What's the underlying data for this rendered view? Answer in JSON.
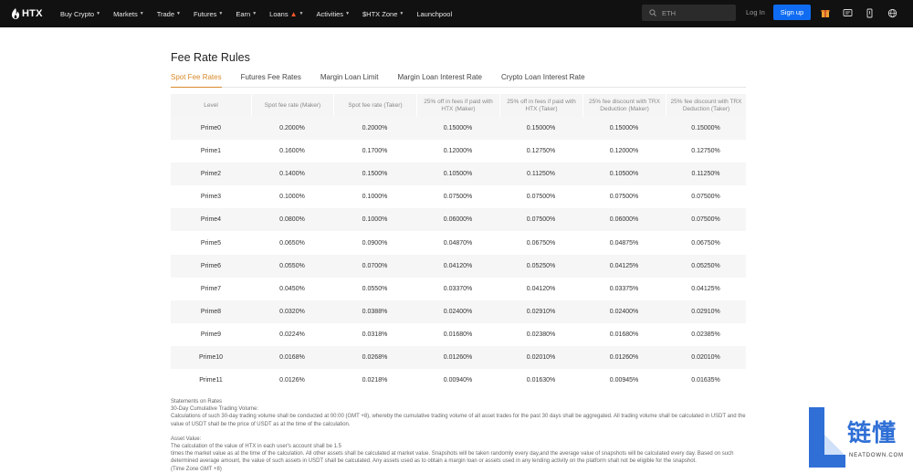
{
  "brand": {
    "logo_text": "HTX"
  },
  "nav": [
    {
      "label": "Buy Crypto",
      "caret": true
    },
    {
      "label": "Markets",
      "caret": true
    },
    {
      "label": "Trade",
      "caret": true
    },
    {
      "label": "Futures",
      "caret": true
    },
    {
      "label": "Earn",
      "caret": true
    },
    {
      "label": "Loans",
      "caret": true,
      "fire": true
    },
    {
      "label": "Activities",
      "caret": true
    },
    {
      "label": "$HTX Zone",
      "caret": true
    },
    {
      "label": "Launchpool",
      "caret": false
    }
  ],
  "search": {
    "placeholder": "ETH"
  },
  "auth": {
    "login": "Log In",
    "signup": "Sign up"
  },
  "page_title": "Fee Rate Rules",
  "tabs": [
    {
      "label": "Spot Fee Rates",
      "active": true
    },
    {
      "label": "Futures Fee Rates",
      "active": false
    },
    {
      "label": "Margin Loan Limit",
      "active": false
    },
    {
      "label": "Margin Loan Interest Rate",
      "active": false
    },
    {
      "label": "Crypto Loan Interest Rate",
      "active": false
    }
  ],
  "table": {
    "headers": [
      "Level",
      "Spot fee rate (Maker)",
      "Spot fee rate (Taker)",
      "25% off in fees if paid with HTX (Maker)",
      "25% off in fees if paid with HTX (Taker)",
      "25% fee discount with TRX Deduction (Maker)",
      "25% fee discount with TRX Deduction (Taker)"
    ],
    "rows": [
      [
        "Prime0",
        "0.2000%",
        "0.2000%",
        "0.15000%",
        "0.15000%",
        "0.15000%",
        "0.15000%"
      ],
      [
        "Prime1",
        "0.1600%",
        "0.1700%",
        "0.12000%",
        "0.12750%",
        "0.12000%",
        "0.12750%"
      ],
      [
        "Prime2",
        "0.1400%",
        "0.1500%",
        "0.10500%",
        "0.11250%",
        "0.10500%",
        "0.11250%"
      ],
      [
        "Prime3",
        "0.1000%",
        "0.1000%",
        "0.07500%",
        "0.07500%",
        "0.07500%",
        "0.07500%"
      ],
      [
        "Prime4",
        "0.0800%",
        "0.1000%",
        "0.06000%",
        "0.07500%",
        "0.06000%",
        "0.07500%"
      ],
      [
        "Prime5",
        "0.0650%",
        "0.0900%",
        "0.04870%",
        "0.06750%",
        "0.04875%",
        "0.06750%"
      ],
      [
        "Prime6",
        "0.0550%",
        "0.0700%",
        "0.04120%",
        "0.05250%",
        "0.04125%",
        "0.05250%"
      ],
      [
        "Prime7",
        "0.0450%",
        "0.0550%",
        "0.03370%",
        "0.04120%",
        "0.03375%",
        "0.04125%"
      ],
      [
        "Prime8",
        "0.0320%",
        "0.0388%",
        "0.02400%",
        "0.02910%",
        "0.02400%",
        "0.02910%"
      ],
      [
        "Prime9",
        "0.0224%",
        "0.0318%",
        "0.01680%",
        "0.02380%",
        "0.01680%",
        "0.02385%"
      ],
      [
        "Prime10",
        "0.0168%",
        "0.0268%",
        "0.01260%",
        "0.02010%",
        "0.01260%",
        "0.02010%"
      ],
      [
        "Prime11",
        "0.0126%",
        "0.0218%",
        "0.00940%",
        "0.01630%",
        "0.00945%",
        "0.01635%"
      ]
    ]
  },
  "statements": {
    "heading": "Statements on Rates",
    "volume_title": "30-Day Cumulative Trading Volume:",
    "volume_text": "Calculations of such 30-day trading volume shall be conducted at 00:00 (GMT +8), whereby the cumulative trading volume of all asset trades for the past 30 days shall be aggregated. All trading volume shall be calculated in USDT and the value of USDT shall be the price of USDT as at the time of the calculation.",
    "asset_title": "Asset Value:",
    "asset_line1": "The calculation of the value of HTX in each user's account shall be 1.5",
    "asset_text": "times the market value as at the time of the calculation. All other assets shall be calculated at market value. Snapshots will be taken randomly every day,and the average value of snapshots will be calculated every day. Based on such determined average amount, the value of such assets in USDT shall be calculated. Any assets used as to obtain a margin loan or assets used in any lending activity on the platform shall not be eligible for the snapshot.",
    "asset_tail": "(Time Zone GMT +8)"
  },
  "watermark": {
    "cn": "链懂",
    "en": "NEATDOWN.COM"
  },
  "colors": {
    "accent": "#d88a2c",
    "signup": "#0f6cf2",
    "topbar": "#111111",
    "watermark": "#2f6fd6"
  }
}
